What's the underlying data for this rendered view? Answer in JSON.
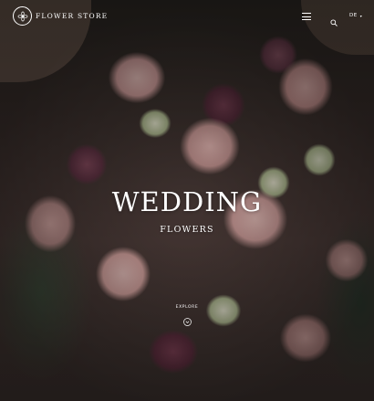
{
  "header": {
    "brand_name": "FLOWER STORE",
    "logo_icon": "flower-logo-icon",
    "menu_icon": "hamburger-menu-icon",
    "search_icon": "search-icon",
    "language": "DE"
  },
  "hero": {
    "title": "WEDDING",
    "subtitle": "FLOWERS",
    "explore_label": "EXPLORE",
    "explore_icon": "chevron-down-circle-icon"
  },
  "colors": {
    "text": "#ffffff"
  }
}
